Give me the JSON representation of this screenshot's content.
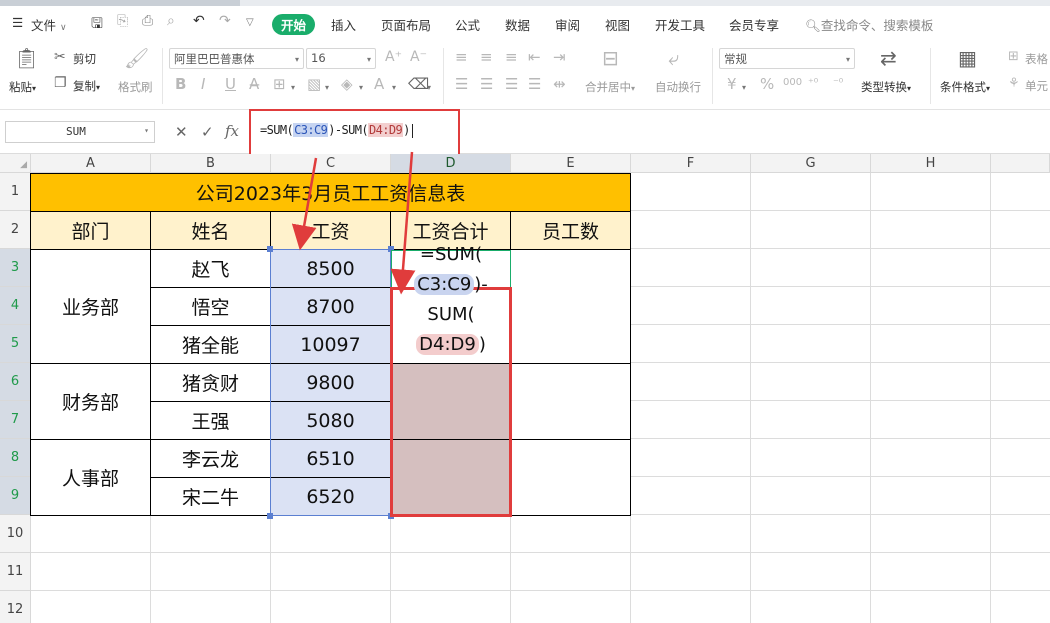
{
  "menu": {
    "file": "文件",
    "tabs": [
      "开始",
      "插入",
      "页面布局",
      "公式",
      "数据",
      "审阅",
      "视图",
      "开发工具",
      "会员专享"
    ],
    "search_placeholder": "查找命令、搜索模板"
  },
  "ribbon": {
    "paste": "粘贴",
    "cut": "剪切",
    "copy": "复制",
    "format_painter": "格式刷",
    "font_name": "阿里巴巴普惠体",
    "font_size": "16",
    "merge_center": "合并居中",
    "wrap_text": "自动换行",
    "number_format": "常规",
    "type_convert": "类型转换",
    "cond_format": "条件格式",
    "table_style": "表格",
    "cell_label": "单元",
    "currency_symbol": "¥",
    "percent_symbol": "%",
    "thousands_symbol": "000",
    "bold": "B",
    "italic": "I",
    "underline": "U"
  },
  "formula_bar": {
    "name_box": "SUM",
    "fx": "fx",
    "formula_prefix": "=SUM(",
    "ref1": "C3:C9",
    "formula_mid": ")-SUM(",
    "ref2": "D4:D9",
    "formula_suffix": ")"
  },
  "grid": {
    "columns": [
      "A",
      "B",
      "C",
      "D",
      "E",
      "F",
      "G",
      "H"
    ],
    "rows": [
      "1",
      "2",
      "3",
      "4",
      "5",
      "6",
      "7",
      "8",
      "9",
      "10",
      "11",
      "12"
    ],
    "title": "公司2023年3月员工工资信息表",
    "headers": [
      "部门",
      "姓名",
      "工资",
      "工资合计",
      "员工数"
    ],
    "departments": [
      "业务部",
      "财务部",
      "人事部"
    ],
    "names": [
      "赵飞",
      "悟空",
      "猪全能",
      "猪贪财",
      "王强",
      "李云龙",
      "宋二牛"
    ],
    "salaries": [
      "8500",
      "8700",
      "10097",
      "9800",
      "5080",
      "6510",
      "6520"
    ],
    "d3_formula": {
      "line1": "=SUM(",
      "ref1": "C3:C9",
      "dash": ")-",
      "line3": "SUM(",
      "ref2": "D4:D9",
      "close": ")"
    }
  },
  "colors": {
    "title_fill": "#ffc000",
    "header_fill": "#fff2cc",
    "range_c": "#dbe2f4",
    "range_d": "#d5bfbf",
    "annotation_red": "#e03c3c",
    "active_tab": "#1aad6b"
  }
}
